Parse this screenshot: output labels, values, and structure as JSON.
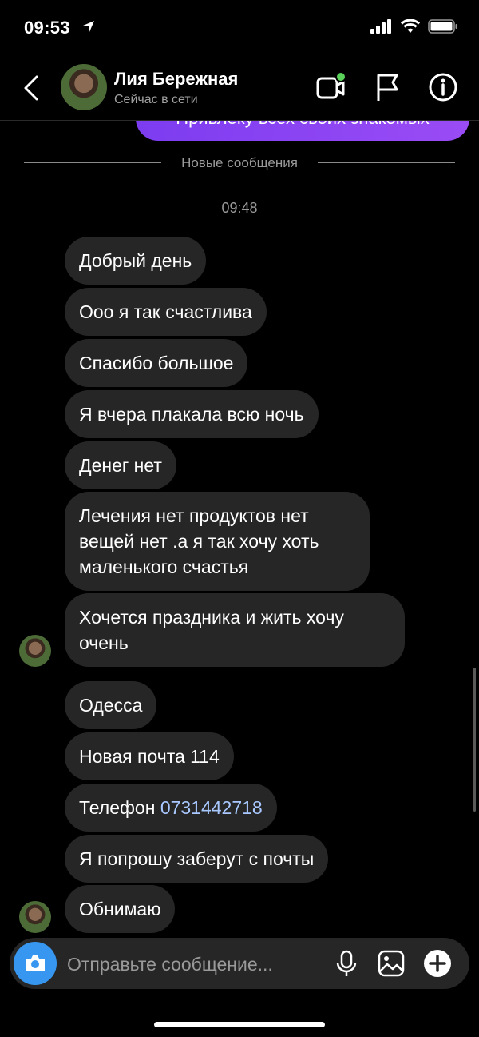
{
  "status_bar": {
    "time": "09:53"
  },
  "header": {
    "contact_name": "Лия Бережная",
    "contact_status": "Сейчас в сети"
  },
  "chat": {
    "outgoing_partial_text": "Привлеку всех своих знакомых",
    "divider_label": "Новые сообщения",
    "timestamp": "09:48",
    "messages": [
      {
        "text": "Добрый день"
      },
      {
        "text": "Ооо я так счастлива"
      },
      {
        "text": "Спасибо большое"
      },
      {
        "text": "Я вчера плакала всю ночь"
      },
      {
        "text": "Денег нет"
      },
      {
        "text": "Лечения нет продуктов нет вещей нет .а я так хочу хоть маленького счастья"
      },
      {
        "text": "Хочется праздника и жить хочу очень"
      },
      {
        "text": "Одесса"
      },
      {
        "text": "Новая почта 114"
      },
      {
        "text_prefix": "Телефон ",
        "phone": "0731442718"
      },
      {
        "text": "Я попрошу заберут с почты"
      },
      {
        "text": "Обнимаю"
      }
    ]
  },
  "composer": {
    "placeholder": "Отправьте сообщение..."
  },
  "colors": {
    "accent_blue": "#3797f0",
    "bubble_incoming": "#262626",
    "bubble_outgoing": "#8a44f2",
    "online_dot": "#5ad25a",
    "phone_link": "#a8c8ff"
  },
  "icons": [
    "location-arrow-icon",
    "signal-icon",
    "wifi-icon",
    "battery-icon",
    "back-chevron-icon",
    "video-call-icon",
    "flag-icon",
    "info-icon",
    "camera-icon",
    "microphone-icon",
    "gallery-icon",
    "plus-icon"
  ]
}
